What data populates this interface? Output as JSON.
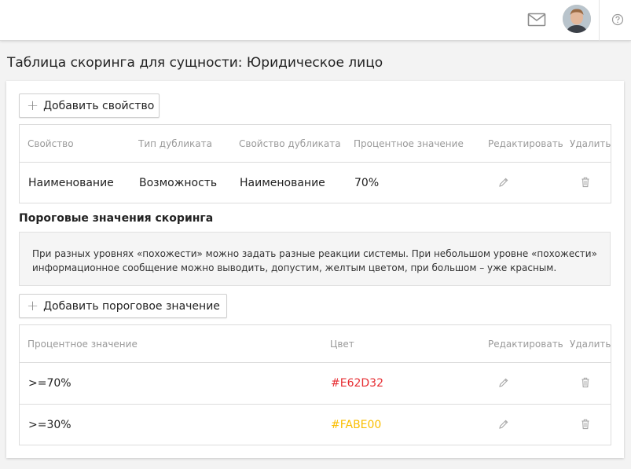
{
  "header": {
    "mail_icon": "mail-icon",
    "help_icon": "help-circle-icon"
  },
  "page": {
    "title": "Таблица скоринга для сущности: Юридическое лицо"
  },
  "properties": {
    "add_button_label": "Добавить свойство",
    "columns": {
      "property": "Свойство",
      "duplicate_type": "Тип дубликата",
      "duplicate_property": "Свойство дубликата",
      "percent": "Процентное значение",
      "edit": "Редактировать",
      "delete": "Удалить"
    },
    "rows": [
      {
        "property": "Наименование",
        "duplicate_type": "Возможность",
        "duplicate_property": "Наименование",
        "percent": "70%"
      }
    ]
  },
  "thresholds": {
    "title": "Пороговые значения скоринга",
    "info": "При разных уровнях «похожести» можно задать разные реакции системы. При небольшом уровне «похожести» информационное сообщение можно выводить, допустим, желтым цветом, при большом – уже красным.",
    "add_button_label": "Добавить пороговое значение",
    "columns": {
      "percent": "Процентное значение",
      "color": "Цвет",
      "edit": "Редактировать",
      "delete": "Удалить"
    },
    "rows": [
      {
        "percent": ">=70%",
        "color": "#E62D32"
      },
      {
        "percent": ">=30%",
        "color": "#FABE00"
      }
    ]
  },
  "icons": {
    "edit": "pencil-icon",
    "delete": "trash-icon",
    "add": "plus-icon"
  }
}
